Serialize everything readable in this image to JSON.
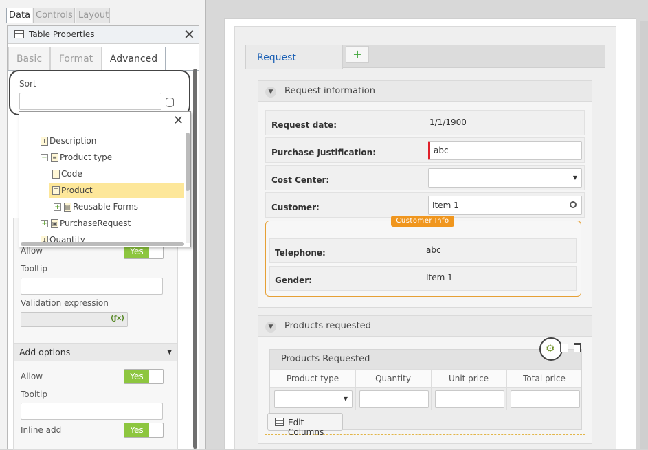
{
  "left_tabs": {
    "data": "Data",
    "controls": "Controls",
    "layout": "Layout"
  },
  "table_properties": {
    "title": "Table Properties",
    "tabs": {
      "basic": "Basic",
      "format": "Format",
      "advanced": "Advanced"
    }
  },
  "sort": {
    "label": "Sort",
    "value": ""
  },
  "tree": {
    "items": [
      "Description",
      "Product type",
      "Code",
      "Product",
      "Reusable Forms",
      "PurchaseRequest",
      "Quantity"
    ],
    "expand_minus": "−",
    "expand_plus": "+"
  },
  "first_options": {
    "allow_label": "Allow",
    "allow_value": "Yes",
    "tooltip_label": "Tooltip",
    "validation_label": "Validation expression",
    "fx": "(ƒx)"
  },
  "add_options": {
    "title": "Add options",
    "allow_label": "Allow",
    "allow_value": "Yes",
    "tooltip_label": "Tooltip",
    "inline_label": "Inline add",
    "inline_value": "Yes"
  },
  "form": {
    "tab": "Request",
    "request_info": {
      "title": "Request information",
      "request_date": {
        "label": "Request date:",
        "value": "1/1/1900"
      },
      "justification": {
        "label": "Purchase Justification:",
        "value": "abc"
      },
      "cost_center": {
        "label": "Cost Center:",
        "value": ""
      },
      "customer": {
        "label": "Customer:",
        "value": "Item 1"
      },
      "customer_info": {
        "legend": "Customer Info",
        "telephone": {
          "label": "Telephone:",
          "value": "abc"
        },
        "gender": {
          "label": "Gender:",
          "value": "Item 1"
        }
      }
    },
    "products": {
      "title": "Products requested",
      "table_title": "Products Requested",
      "columns": [
        "Product type",
        "Quantity",
        "Unit price",
        "Total price"
      ],
      "edit_columns": "Edit Columns"
    }
  },
  "colors": {
    "accent_blue": "#1a5fb4",
    "required_red": "#e0202a",
    "legend_orange": "#f0961e",
    "toggle_green": "#8dc63f",
    "highlight": "#fde79a"
  }
}
